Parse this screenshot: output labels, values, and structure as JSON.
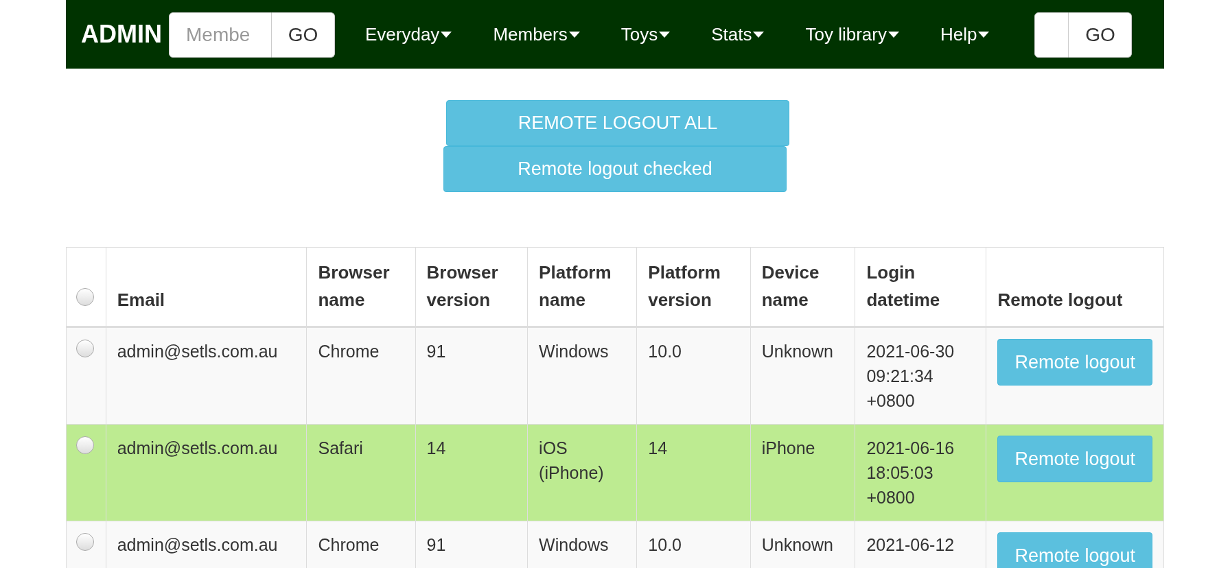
{
  "navbar": {
    "brand": "ADMIN",
    "member_search": {
      "placeholder": "Membe",
      "button": "GO"
    },
    "menus": [
      {
        "label": "Everyday"
      },
      {
        "label": "Members"
      },
      {
        "label": "Toys"
      },
      {
        "label": "Stats"
      },
      {
        "label": "Toy library"
      },
      {
        "label": "Help"
      }
    ],
    "quick_search": {
      "button": "GO"
    }
  },
  "actions": [
    "REMOTE LOGOUT ALL",
    "Remote logout checked"
  ],
  "table": {
    "select_all_checked": false,
    "columns": [
      "Email",
      "Browser name",
      "Browser version",
      "Platform name",
      "Platform version",
      "Device name",
      "Login datetime",
      "Remote logout"
    ],
    "rows": [
      {
        "checked": false,
        "highlighted": false,
        "cells": [
          "admin@setls.com.au",
          "Chrome",
          "91",
          "Windows",
          "10.0",
          "Unknown",
          "2021-06-30 09:21:34 +0800"
        ],
        "button": "Remote logout"
      },
      {
        "checked": false,
        "highlighted": true,
        "cells": [
          "admin@setls.com.au",
          "Safari",
          "14",
          "iOS (iPhone)",
          "14",
          "iPhone",
          "2021-06-16 18:05:03 +0800"
        ],
        "button": "Remote logout"
      },
      {
        "checked": false,
        "highlighted": false,
        "cells": [
          "admin@setls.com.au",
          "Chrome",
          "91",
          "Windows",
          "10.0",
          "Unknown",
          "2021-06-12"
        ],
        "button": "Remote logout"
      }
    ]
  }
}
